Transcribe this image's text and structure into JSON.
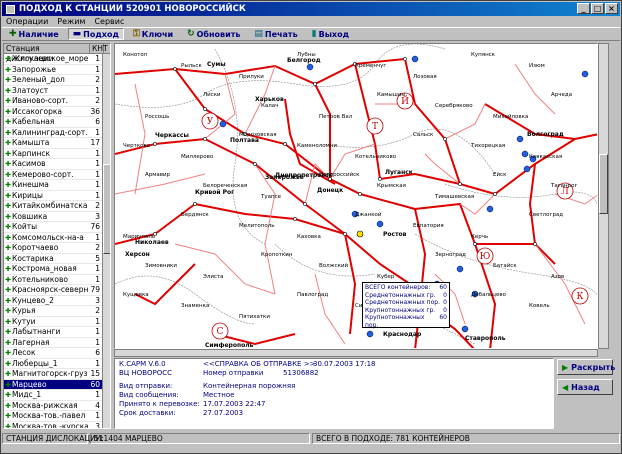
{
  "window": {
    "title": "ПОДХОД К СТАНЦИИ 520901   НОВОРОССИЙСК"
  },
  "menu": [
    "Операции",
    "Режим",
    "Сервис"
  ],
  "toolbar": {
    "buttons": [
      {
        "label": "Наличие",
        "icon": "check-icon"
      },
      {
        "label": "Подход",
        "icon": "train-icon"
      },
      {
        "label": "Ключи",
        "icon": "key-icon"
      },
      {
        "label": "Обновить",
        "icon": "refresh-icon"
      },
      {
        "label": "Печать",
        "icon": "printer-icon"
      },
      {
        "label": "Выход",
        "icon": "exit-icon"
      }
    ]
  },
  "stations_panel": {
    "header_name": "Станция дислокации",
    "header_count": "КНТ",
    "rows": [
      {
        "name": "Жигулевское_море",
        "count": "1"
      },
      {
        "name": "Запорожье",
        "count": "1"
      },
      {
        "name": "Зеленый_дол",
        "count": "2"
      },
      {
        "name": "Златоуст",
        "count": "1"
      },
      {
        "name": "Иваново-сорт.",
        "count": "2"
      },
      {
        "name": "Иссакогорка",
        "count": "36"
      },
      {
        "name": "Кабельная",
        "count": "6"
      },
      {
        "name": "Калининград-сорт.",
        "count": "1"
      },
      {
        "name": "Камышта",
        "count": "17"
      },
      {
        "name": "Карпинск",
        "count": "1"
      },
      {
        "name": "Касимов",
        "count": "1"
      },
      {
        "name": "Кемерово-сорт.",
        "count": "1"
      },
      {
        "name": "Кинешма",
        "count": "1"
      },
      {
        "name": "Кирицы",
        "count": "1"
      },
      {
        "name": "Китайкомбинатская",
        "count": "2"
      },
      {
        "name": "Ковшика",
        "count": "3"
      },
      {
        "name": "Койты",
        "count": "76"
      },
      {
        "name": "Комсомольск-на-а",
        "count": "1"
      },
      {
        "name": "Коротчаево",
        "count": "2"
      },
      {
        "name": "Костарика",
        "count": "5"
      },
      {
        "name": "Кострома_новая",
        "count": "1"
      },
      {
        "name": "Котельниково",
        "count": "1"
      },
      {
        "name": "Красноярск-северн",
        "count": "79"
      },
      {
        "name": "Кунцево_2",
        "count": "3"
      },
      {
        "name": "Курья",
        "count": "2"
      },
      {
        "name": "Кутуи",
        "count": "1"
      },
      {
        "name": "Лабытнанги",
        "count": "1"
      },
      {
        "name": "Лагерная",
        "count": "1"
      },
      {
        "name": "Лесок",
        "count": "6"
      },
      {
        "name": "Люберцы_1",
        "count": "1"
      },
      {
        "name": "Магнитогорск-груз.",
        "count": "15"
      },
      {
        "name": "Марцево",
        "count": "60",
        "selected": true
      },
      {
        "name": "Мидс_1",
        "count": "1"
      },
      {
        "name": "Москва-рижская",
        "count": "4"
      },
      {
        "name": "Москва-тов.-павел",
        "count": "1"
      },
      {
        "name": "Москва-тов.-курская",
        "count": "3"
      }
    ]
  },
  "map": {
    "regions": [
      "У",
      "Т",
      "Й",
      "Л",
      "Ю",
      "С",
      "К"
    ],
    "cities_bold": [
      "Сумы",
      "Белгород",
      "Харьков",
      "Полтава",
      "Луганск",
      "Донецк",
      "Ростов",
      "Волгоград",
      "Краснодар",
      "Ставрополь",
      "Симферополь",
      "Запорожье",
      "Днепропетровск",
      "Кривой Рог",
      "Николаев",
      "Херсон",
      "Черкассы"
    ],
    "cities": [
      "Конотоп",
      "Рыльск",
      "Прилуки",
      "Лубны",
      "Кременчуг",
      "Лозовая",
      "Купянск",
      "Изюм",
      "Россошь",
      "Лиски",
      "Калач",
      "Петров Вал",
      "Камышин",
      "Серебряково",
      "Михайловка",
      "Арчеда",
      "Чертково",
      "Миллерово",
      "Морозовская",
      "Каменоломни",
      "Котельниково",
      "Сальск",
      "Тихорецкая",
      "Кавказская",
      "Армавир",
      "Белореченская",
      "Туапсе",
      "Новороссийск",
      "Крымская",
      "Тимашевская",
      "Ейск",
      "Таганрог",
      "Мариуполь",
      "Бердянск",
      "Мелитополь",
      "Каховка",
      "Джанкой",
      "Евпатория",
      "Керчь",
      "Светлоград",
      "Зимовники",
      "Элиста",
      "Кропоткин",
      "Волжский",
      "Кубер",
      "Зерноград",
      "Батайск",
      "Азов",
      "Кущевка",
      "Знаменка",
      "Пятихатки",
      "Павлоград",
      "Синельниково",
      "Ясиноватая",
      "Дебальцево",
      "Ковель"
    ],
    "tooltip": {
      "rows": [
        {
          "label": "ВСЕГО контейнеров:",
          "value": "60"
        },
        {
          "label": "Среднетоннажных гр.",
          "value": "0"
        },
        {
          "label": "Среднетоннажных пор.",
          "value": "0"
        },
        {
          "label": "Крупнотоннажных гр.",
          "value": "0"
        },
        {
          "label": "Крупнотоннажных пор.",
          "value": "60"
        }
      ]
    }
  },
  "info": {
    "line1_a": "К.САРМ V.6.0",
    "line1_b": "<<СПРАВКА ОБ ОТПРАВКЕ >>",
    "line1_c": "30.07.2003 17:18",
    "line2_a": "ВЦ НОВОРОСС",
    "line2_b": "Номер отправки",
    "line2_c": "51306882",
    "rows": [
      {
        "label": "Вид отправки:",
        "value": "Контейнерная порожняя"
      },
      {
        "label": "Вид сообщения:",
        "value": "Местное"
      },
      {
        "label": "Принято к перевозке:",
        "value": "17.07.2003 22:47"
      },
      {
        "label": "Срок доставки:",
        "value": "27.07.2003"
      }
    ]
  },
  "side_buttons": [
    {
      "label": "Раскрыть",
      "icon": "expand-arrow-icon"
    },
    {
      "label": "Назад",
      "icon": "back-arrow-icon"
    }
  ],
  "status": {
    "station": "СТАНЦИЯ ДИСЛОКАЦИИ:",
    "station_code": "511404  МАРЦЕВО",
    "total": "ВСЕГО В ПОДХОДЕ: 781 КОНТЕЙНЕРОВ"
  },
  "colors": {
    "title_start": "#000080",
    "rail_main": "#e00000",
    "rail_minor": "#f08080",
    "border": "#000000"
  }
}
